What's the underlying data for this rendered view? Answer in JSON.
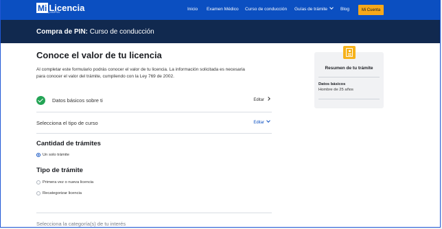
{
  "nav": {
    "logo_mi": "Mi",
    "logo_name": "Licencia",
    "logo_tagline": "by ANPRA",
    "links": [
      "Inicio",
      "Examen Médico",
      "Curso de conducción",
      "Guías de trámite",
      "Blog"
    ],
    "account_button": "Mi Cuenta"
  },
  "header": {
    "prefix": "Compra de PIN:",
    "title": "Curso de conducción"
  },
  "main": {
    "title": "Conoce el valor de tu licencia",
    "description": "Al completar este formulario podrás conocer el valor de tu licencia. La información solicitada es necesaria para conocer el valor del trámite, cumpliendo con la Ley 769 de 2002.",
    "step_basic": {
      "label": "Datos básicos sobre ti",
      "action": "Editar"
    },
    "step_course": {
      "label": "Selecciona el tipo de curso",
      "action": "Editar"
    },
    "quantity": {
      "title": "Cantidad de trámites",
      "options": [
        "Un solo trámite"
      ],
      "selected": "Un solo trámite"
    },
    "tramite_type": {
      "title": "Tipo de trámite",
      "options": [
        "Primera vez o nueva licencia",
        "Recategorizar licencia"
      ]
    },
    "next_step": "Selecciona la categoría(s) de tu interés"
  },
  "summary": {
    "icon": "id-card-icon",
    "title": "Resumen de tu trámite",
    "section_label": "Datos básicos",
    "section_value": "Hombre de 25 años"
  },
  "colors": {
    "nav_bg": "#0b4fc1",
    "header_bg": "#11294f",
    "accent": "#f6a81a",
    "success": "#23a455"
  }
}
